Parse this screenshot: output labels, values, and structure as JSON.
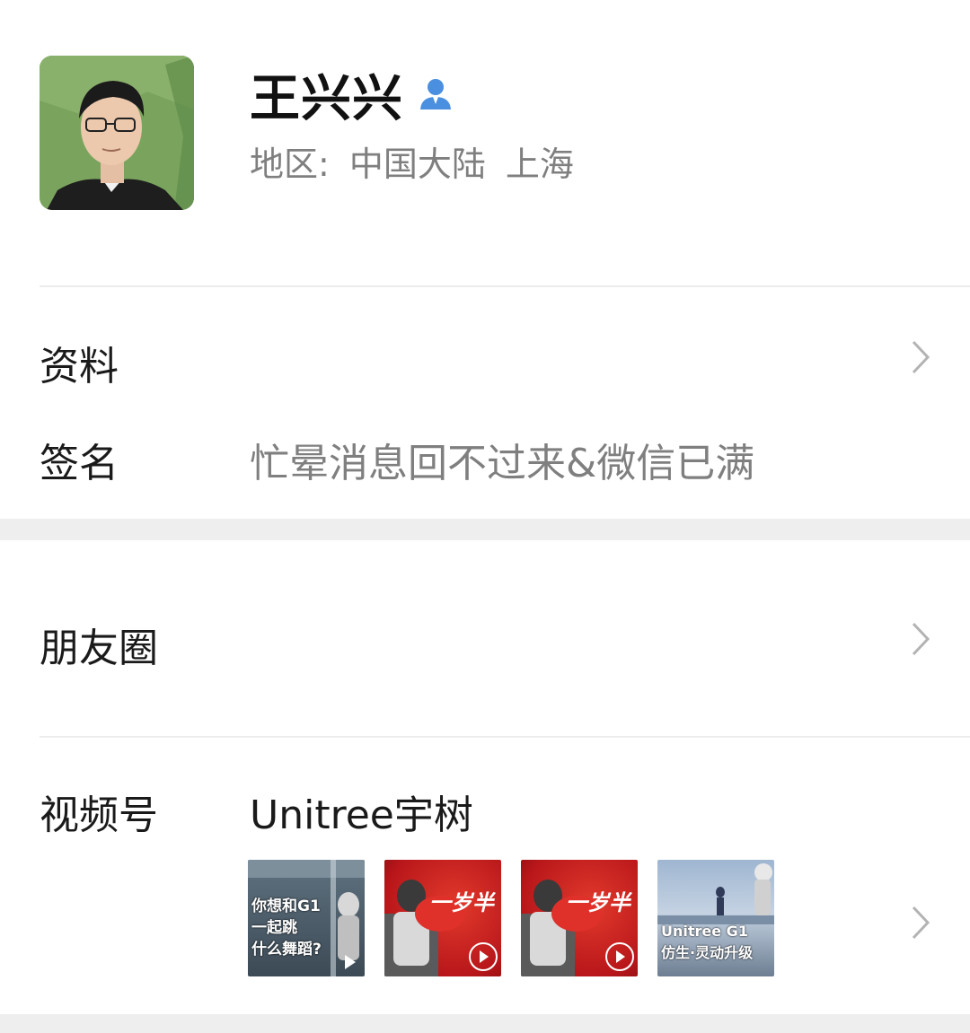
{
  "profile": {
    "name": "王兴兴",
    "region_label": "地区:",
    "region_country": "中国大陆",
    "region_city": "上海"
  },
  "rows": {
    "info_label": "资料",
    "signature_label": "签名",
    "signature_value": "忙晕消息回不过来&微信已满",
    "moments_label": "朋友圈",
    "channels_label": "视频号",
    "channels_value": "Unitree宇树"
  },
  "thumbnails": [
    {
      "caption": "你想和G1\n一起跳\n什么舞蹈?",
      "icon": "play-icon"
    },
    {
      "caption": "一岁半",
      "icon": "play-icon"
    },
    {
      "caption": "一岁半",
      "icon": "play-icon"
    },
    {
      "caption": "Unitree G1\n仿生·灵动升级",
      "icon": "play-icon"
    }
  ],
  "colors": {
    "accent_blue": "#4a8fe0",
    "secondary_text": "#7f7f7f",
    "divider": "#ececec",
    "thumb_red": "#c8201e"
  }
}
